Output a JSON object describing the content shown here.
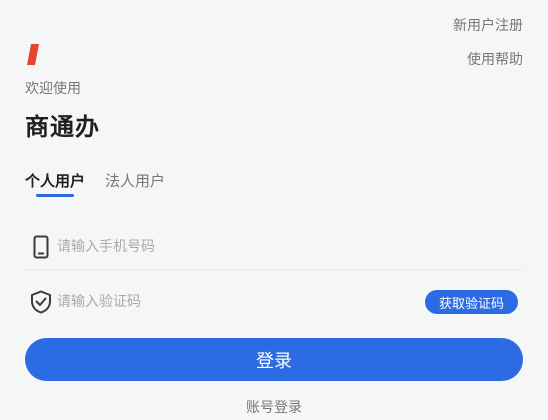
{
  "header": {
    "register_link": "新用户注册",
    "help_link": "使用帮助"
  },
  "brand": {
    "welcome": "欢迎使用",
    "app_name": "商通办",
    "logo_color": "#e8432e"
  },
  "tabs": [
    {
      "label": "个人用户",
      "active": true
    },
    {
      "label": "法人用户",
      "active": false
    }
  ],
  "form": {
    "phone_placeholder": "请输入手机号码",
    "phone_icon": "phone-icon",
    "code_placeholder": "请输入验证码",
    "code_icon": "shield-check-icon",
    "get_code_label": "获取验证码"
  },
  "actions": {
    "login_label": "登录",
    "account_login_link": "账号登录"
  },
  "colors": {
    "accent": "#2d6be4",
    "background": "#f5f6f8"
  }
}
